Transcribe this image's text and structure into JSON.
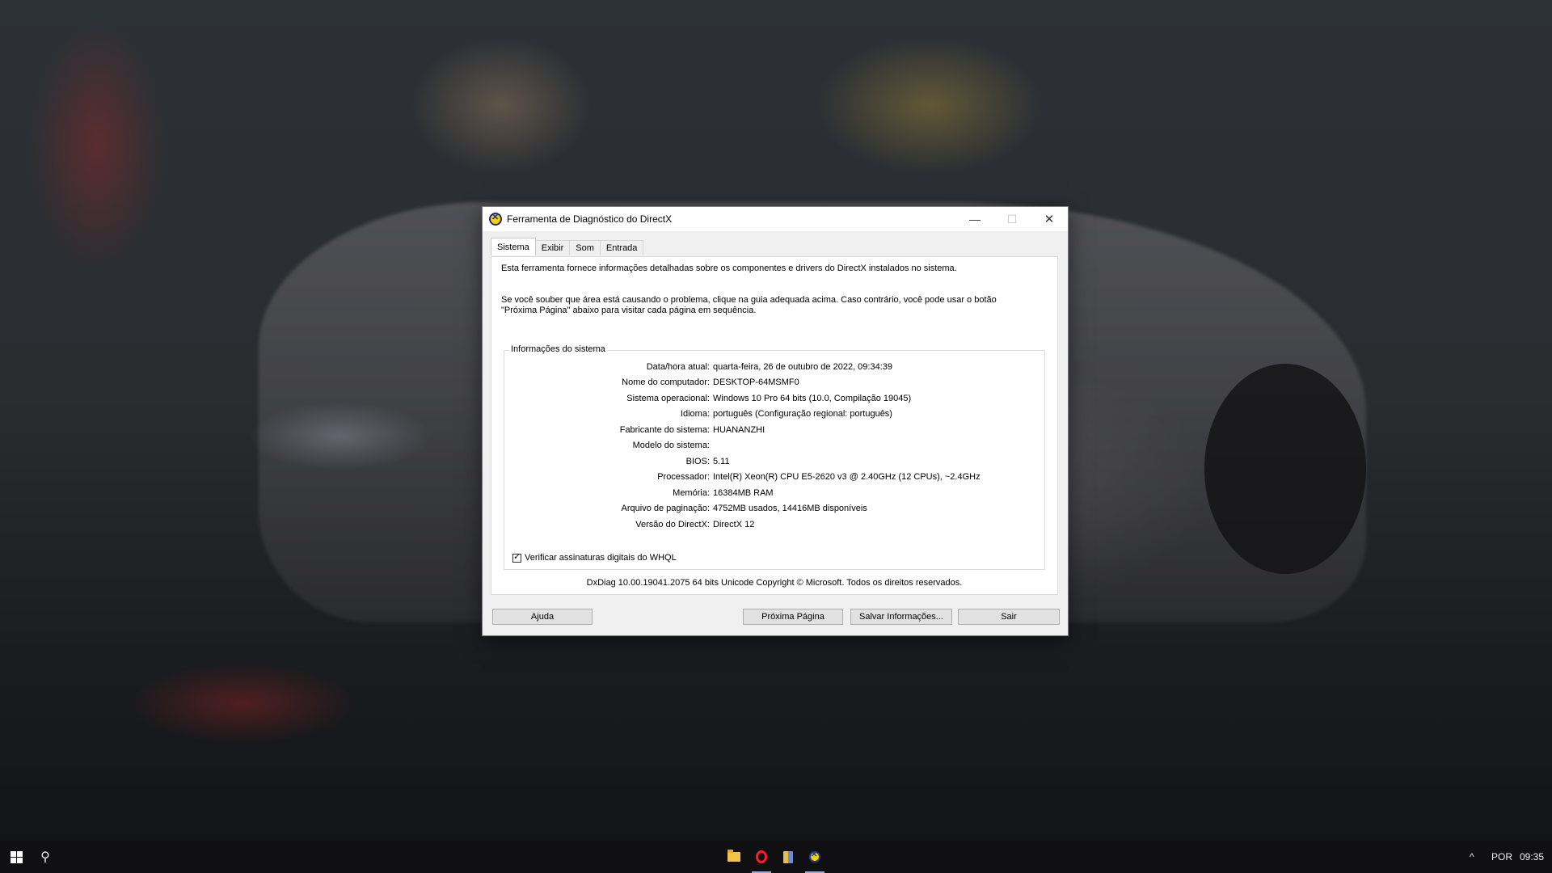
{
  "window": {
    "title": "Ferramenta de Diagnóstico do DirectX",
    "minimize_icon": "minimize-icon",
    "maximize_icon": "maximize-icon",
    "close_icon": "close-icon"
  },
  "tabs": [
    {
      "label": "Sistema",
      "active": true
    },
    {
      "label": "Exibir",
      "active": false
    },
    {
      "label": "Som",
      "active": false
    },
    {
      "label": "Entrada",
      "active": false
    }
  ],
  "panel": {
    "intro": "Esta ferramenta fornece informações detalhadas sobre os componentes e drivers do DirectX instalados no sistema.",
    "hint": "Se você souber que área está causando o problema, clique na guia adequada acima. Caso contrário, você pode usar o botão \"Próxima Página\" abaixo para visitar cada página em sequência.",
    "group_title": "Informações do sistema",
    "rows": [
      {
        "label": "Data/hora atual:",
        "value": "quarta-feira, 26 de outubro de 2022, 09:34:39"
      },
      {
        "label": "Nome do computador:",
        "value": "DESKTOP-64MSMF0"
      },
      {
        "label": "Sistema operacional:",
        "value": "Windows 10 Pro 64 bits (10.0, Compilação 19045)"
      },
      {
        "label": "Idioma:",
        "value": "português (Configuração regional: português)"
      },
      {
        "label": "Fabricante do sistema:",
        "value": "HUANANZHI"
      },
      {
        "label": "Modelo do sistema:",
        "value": ""
      },
      {
        "label": "BIOS:",
        "value": "5.11"
      },
      {
        "label": "Processador:",
        "value": "Intel(R) Xeon(R) CPU E5-2620 v3 @ 2.40GHz (12 CPUs), ~2.4GHz"
      },
      {
        "label": "Memória:",
        "value": "16384MB RAM"
      },
      {
        "label": "Arquivo de paginação:",
        "value": "4752MB usados, 14416MB disponíveis"
      },
      {
        "label": "Versão do DirectX:",
        "value": "DirectX 12"
      }
    ],
    "whql_label": "Verificar assinaturas digitais do WHQL",
    "whql_checked": true,
    "footer": "DxDiag 10.00.19041.2075 64 bits Unicode  Copyright © Microsoft. Todos os direitos reservados."
  },
  "buttons": {
    "help": "Ajuda",
    "next": "Próxima Página",
    "save": "Salvar Informações...",
    "exit": "Sair"
  },
  "taskbar": {
    "icons": [
      "windows-start-icon",
      "search-icon",
      "file-explorer-icon",
      "opera-browser-icon",
      "app-icon",
      "directx-diagnostic-icon"
    ],
    "language": "POR",
    "time": "09:35",
    "chevron": "^"
  }
}
